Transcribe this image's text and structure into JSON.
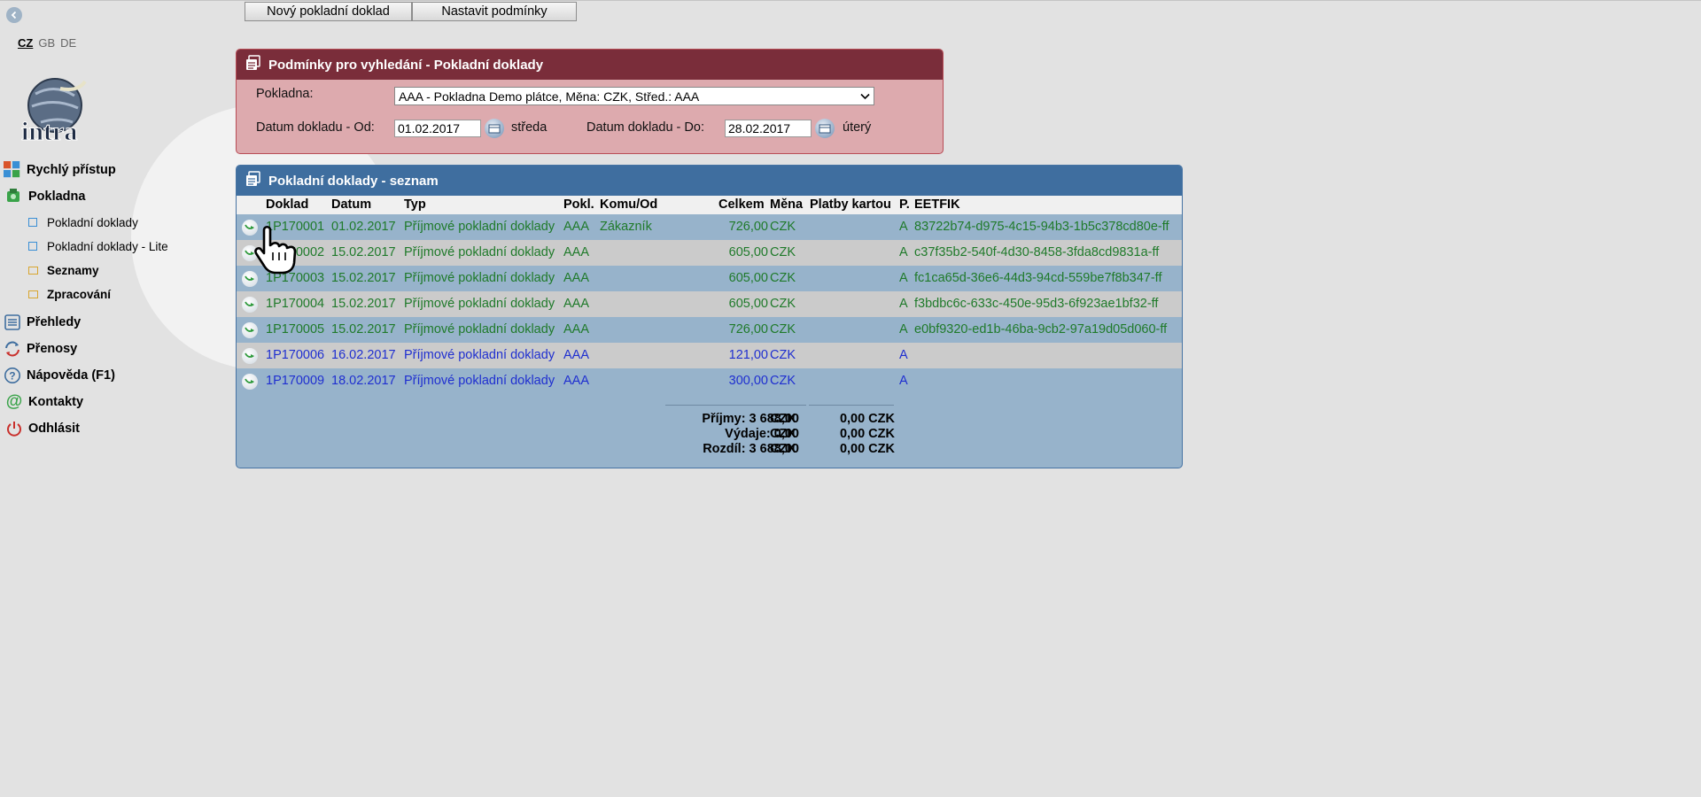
{
  "toolbar": {
    "new_label": "Nový pokladní doklad",
    "conditions_label": "Nastavit podmínky"
  },
  "languages": [
    {
      "code": "CZ",
      "active": true
    },
    {
      "code": "GB",
      "active": false
    },
    {
      "code": "DE",
      "active": false
    }
  ],
  "logo": {
    "text": "intra"
  },
  "nav": {
    "quick": "Rychlý přístup",
    "cash": "Pokladna",
    "docs": "Pokladní doklady",
    "docs_lite": "Pokladní doklady - Lite",
    "lists": "Seznamy",
    "processing": "Zpracování",
    "overview": "Přehledy",
    "transfers": "Přenosy",
    "help": "Nápověda (F1)",
    "contacts": "Kontakty",
    "logout": "Odhlásit"
  },
  "filter": {
    "title": "Podmínky pro vyhledání - Pokladní doklady",
    "cash_label": "Pokladna:",
    "cash_value": "AAA - Pokladna Demo plátce, Měna: CZK, Střed.: AAA",
    "from_label": "Datum dokladu - Od:",
    "from_value": "01.02.2017",
    "from_day": "středa",
    "to_label": "Datum dokladu - Do:",
    "to_value": "28.02.2017",
    "to_day": "úterý"
  },
  "list": {
    "title": "Pokladní doklady - seznam",
    "columns": {
      "doklad": "Doklad",
      "datum": "Datum",
      "typ": "Typ",
      "pokl": "Pokl.",
      "komu": "Komu/Od",
      "celkem": "Celkem",
      "mena": "Měna",
      "karta": "Platby kartou",
      "p": "P.",
      "eet": "EETFIK"
    },
    "rows": [
      {
        "doklad": "1P170001",
        "datum": "01.02.2017",
        "typ": "Příjmové pokladní doklady",
        "pokl": "AAA",
        "komu": "Zákazník",
        "celkem": "726,00",
        "mena": "CZK",
        "karta": "",
        "p": "A",
        "eet": "83722b74-d975-4c15-94b3-1b5c378cd80e-ff"
      },
      {
        "doklad": "1P170002",
        "datum": "15.02.2017",
        "typ": "Příjmové pokladní doklady",
        "pokl": "AAA",
        "komu": "",
        "celkem": "605,00",
        "mena": "CZK",
        "karta": "",
        "p": "A",
        "eet": "c37f35b2-540f-4d30-8458-3fda8cd9831a-ff"
      },
      {
        "doklad": "1P170003",
        "datum": "15.02.2017",
        "typ": "Příjmové pokladní doklady",
        "pokl": "AAA",
        "komu": "",
        "celkem": "605,00",
        "mena": "CZK",
        "karta": "",
        "p": "A",
        "eet": "fc1ca65d-36e6-44d3-94cd-559be7f8b347-ff"
      },
      {
        "doklad": "1P170004",
        "datum": "15.02.2017",
        "typ": "Příjmové pokladní doklady",
        "pokl": "AAA",
        "komu": "",
        "celkem": "605,00",
        "mena": "CZK",
        "karta": "",
        "p": "A",
        "eet": "f3bdbc6c-633c-450e-95d3-6f923ae1bf32-ff"
      },
      {
        "doklad": "1P170005",
        "datum": "15.02.2017",
        "typ": "Příjmové pokladní doklady",
        "pokl": "AAA",
        "komu": "",
        "celkem": "726,00",
        "mena": "CZK",
        "karta": "",
        "p": "A",
        "eet": "e0bf9320-ed1b-46ba-9cb2-97a19d05d060-ff"
      },
      {
        "doklad": "1P170006",
        "datum": "16.02.2017",
        "typ": "Příjmové pokladní doklady",
        "pokl": "AAA",
        "komu": "",
        "celkem": "121,00",
        "mena": "CZK",
        "karta": "",
        "p": "A",
        "eet": ""
      },
      {
        "doklad": "1P170009",
        "datum": "18.02.2017",
        "typ": "Příjmové pokladní doklady",
        "pokl": "AAA",
        "komu": "",
        "celkem": "300,00",
        "mena": "CZK",
        "karta": "",
        "p": "A",
        "eet": ""
      }
    ],
    "summary": {
      "income": "Příjmy: 3 688,00",
      "income_cur": "CZK",
      "income_card": "0,00 CZK",
      "expense": "Výdaje: 0,00",
      "expense_cur": "CZK",
      "expense_card": "0,00 CZK",
      "diff": "Rozdíl: 3 688,00",
      "diff_cur": "CZK",
      "diff_card": "0,00 CZK"
    }
  },
  "colors": {
    "filter_header": "#7a2d3a",
    "filter_body": "#ddaaae",
    "list_header": "#3f6e9f",
    "row_odd": "#97b3cb",
    "row_even": "#cbcbcb",
    "text_green": "#1f7a2a",
    "text_blue": "#1f2fd0"
  }
}
